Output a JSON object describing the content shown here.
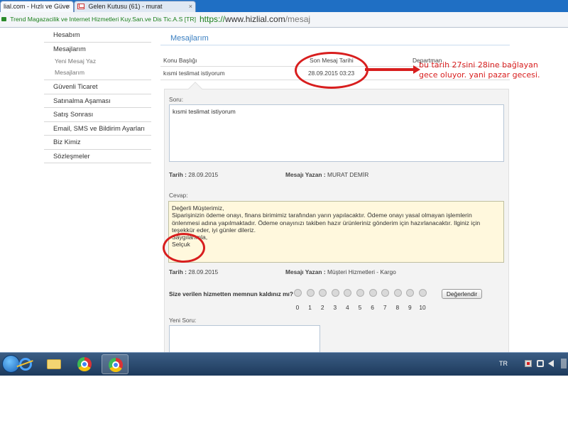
{
  "browser": {
    "tabs": [
      {
        "title": "lial.com - Hızlı ve Güve",
        "close": "×"
      },
      {
        "title": "Gelen Kutusu (61) - murat",
        "close": "×"
      }
    ],
    "certificate": "Trend Magazacilik ve Internet Hizmetleri Kuy.San.ve Dis Tic.A.S [TR]",
    "url": {
      "scheme": "https://",
      "host": "www.hizlial.com",
      "path": "/mesaj"
    }
  },
  "sidebar": {
    "items": [
      {
        "label": "Hesabım"
      },
      {
        "label": "Mesajlarım"
      },
      {
        "label": "Yeni Mesaj Yaz",
        "sub": true
      },
      {
        "label": "Mesajlarım",
        "sub": true
      },
      {
        "label": "Güvenli Ticaret"
      },
      {
        "label": "Satınalma Aşaması"
      },
      {
        "label": "Satış Sonrası"
      },
      {
        "label": "Email, SMS ve Bildirim Ayarları"
      },
      {
        "label": "Biz Kimiz"
      },
      {
        "label": "Sözleşmeler"
      }
    ]
  },
  "main": {
    "title": "Mesajlarım",
    "table": {
      "headers": [
        "Konu Başlığı",
        "Son Mesaj Tarihi",
        "Departman"
      ],
      "row": [
        "kısmi teslimat istiyorum",
        "28.09.2015 03:23",
        ""
      ]
    },
    "question": {
      "label": "Soru:",
      "text": "kısmi teslimat istiyorum",
      "date_label": "Tarih :",
      "date": "28.09.2015",
      "author_label": "Mesajı Yazan :",
      "author": "MURAT DEMİR"
    },
    "answer": {
      "label": "Cevap:",
      "lines": [
        "Değerli Müşterimiz,",
        "Siparişinizin ödeme onayı, finans birimimiz tarafından yarın yapılacaktır. Ödeme onayı yasal olmayan işlemlerin",
        "önlenmesi adına yapılmaktadır. Ödeme onayınızı takiben hazır ürünleriniz  gönderim için hazırlanacaktır. Ilginiz için",
        "teşekkür eder, iyi günler dileriz.",
        "Saygılarımla,",
        "Selçuk"
      ],
      "date_label": "Tarih :",
      "date": "28.09.2015",
      "author_label": "Mesajı Yazan :",
      "author": "Müşteri Hizmetleri - Kargo"
    },
    "rating": {
      "question": "Size verilen hizmetten memnun kaldınız mı?",
      "scale": [
        "0",
        "1",
        "2",
        "3",
        "4",
        "5",
        "6",
        "7",
        "8",
        "9",
        "10"
      ],
      "button": "Değerlendir"
    },
    "new_question": {
      "label": "Yeni Soru:"
    }
  },
  "annotation": {
    "color": "#d81e1e",
    "lines": [
      "bu tarih 27sini 28ine bağlayan",
      "gece oluyor. yani pazar gecesi."
    ]
  },
  "taskbar": {
    "apps": [
      "internet-explorer-icon",
      "folder-icon",
      "chrome-icon",
      "chrome-icon"
    ],
    "language": "TR"
  }
}
